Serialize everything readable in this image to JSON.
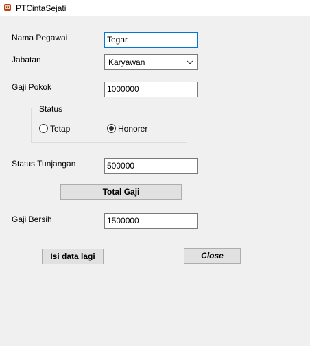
{
  "window": {
    "title": "PTCintaSejati",
    "icon": "app-icon"
  },
  "form": {
    "nama_pegawai": {
      "label": "Nama Pegawai",
      "value": "Tegar"
    },
    "jabatan": {
      "label": "Jabatan",
      "selected": "Karyawan"
    },
    "gaji_pokok": {
      "label": "Gaji Pokok",
      "value": "1000000"
    },
    "status": {
      "title": "Status",
      "options": [
        {
          "label": "Tetap",
          "checked": false
        },
        {
          "label": "Honorer",
          "checked": true
        }
      ]
    },
    "status_tunjangan": {
      "label": "Status Tunjangan",
      "value": "500000"
    },
    "total_gaji_button": "Total Gaji",
    "gaji_bersih": {
      "label": "Gaji Bersih",
      "value": "1500000"
    },
    "isi_data_lagi_button": "Isi data lagi",
    "close_button": "Close"
  },
  "colors": {
    "window_background": "#f0f0f0",
    "focus_border": "#0078d7",
    "button_face": "#e1e1e1"
  }
}
